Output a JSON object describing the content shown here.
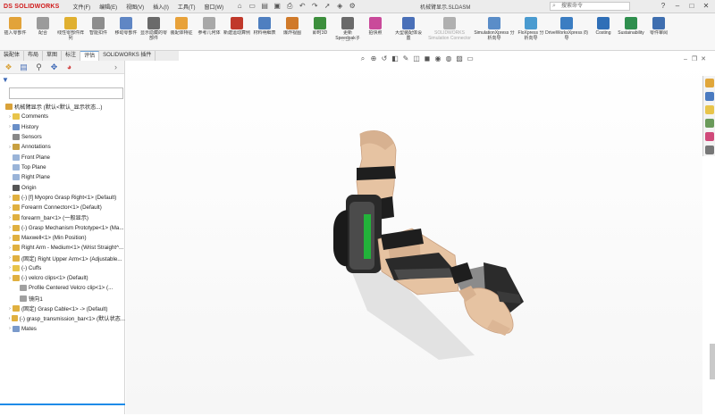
{
  "app": {
    "logo_text": "DS SOLIDWORKS",
    "document_title": "机械臂显示.SLDASM",
    "search_placeholder": "搜索命令"
  },
  "menu": [
    "文件(F)",
    "编辑(E)",
    "视图(V)",
    "插入(I)",
    "工具(T)",
    "窗口(W)"
  ],
  "commands": [
    {
      "label": "插入零部件",
      "color": "#e2a33a",
      "disabled": false
    },
    {
      "label": "配合",
      "color": "#9b9b9b",
      "disabled": false
    },
    {
      "label": "线性零部件阵列",
      "color": "#e0b030",
      "disabled": false
    },
    {
      "label": "智能扣件",
      "color": "#8d8d8d",
      "disabled": false
    },
    {
      "label": "移动零部件",
      "color": "#5f86c4",
      "disabled": false
    },
    {
      "label": "显示隐藏的零部件",
      "color": "#6a6a6a",
      "disabled": false
    },
    {
      "label": "装配体特征",
      "color": "#e8a23a",
      "disabled": false
    },
    {
      "label": "参考几何体",
      "color": "#a8a8a8",
      "disabled": false
    },
    {
      "label": "新建运动算例",
      "color": "#c0392b",
      "disabled": false
    },
    {
      "label": "材料明细表",
      "color": "#4f7fc0",
      "disabled": false
    },
    {
      "label": "爆炸视图",
      "color": "#d07a2a",
      "disabled": false
    },
    {
      "label": "即时3D",
      "color": "#3d8f3d",
      "disabled": false
    },
    {
      "label": "更新Speedpak子装配体",
      "color": "#6a6a6a",
      "disabled": false
    },
    {
      "label": "拍快照",
      "color": "#c94a9a",
      "disabled": false
    },
    {
      "label": "大型装配体设置",
      "color": "#4a70b8",
      "disabled": false
    },
    {
      "label": "SOLIDWORKS Simulation Connector",
      "color": "#b0b0b0",
      "disabled": true
    },
    {
      "label": "SimulationXpress 分析向导",
      "color": "#5a8dc8",
      "disabled": false
    },
    {
      "label": "FloXpress 分析向导",
      "color": "#4a9bd0",
      "disabled": false
    },
    {
      "label": "DriveWorksXpress 向导",
      "color": "#3b7dc2",
      "disabled": false
    },
    {
      "label": "Costing",
      "color": "#2f6fb7",
      "disabled": false
    },
    {
      "label": "Sustainability",
      "color": "#2f8f4e",
      "disabled": false
    },
    {
      "label": "零件审阅",
      "color": "#3f6fb0",
      "disabled": false
    }
  ],
  "tabs": [
    {
      "label": "装配体",
      "active": false
    },
    {
      "label": "布局",
      "active": false
    },
    {
      "label": "草图",
      "active": false
    },
    {
      "label": "标注",
      "active": false
    },
    {
      "label": "评估",
      "active": true
    },
    {
      "label": "SOLIDWORKS 插件",
      "active": false
    }
  ],
  "tree": [
    {
      "label": "机械臂显示 (默认<默认_显示状态...)",
      "indent": 0,
      "icon": "#d9a23a",
      "exp": ""
    },
    {
      "label": "Comments",
      "indent": 1,
      "icon": "#e8c44a",
      "exp": "›"
    },
    {
      "label": "History",
      "indent": 1,
      "icon": "#6a8fc8",
      "exp": "›"
    },
    {
      "label": "Sensors",
      "indent": 1,
      "icon": "#888888",
      "exp": ""
    },
    {
      "label": "Annotations",
      "indent": 1,
      "icon": "#c8a040",
      "exp": "›"
    },
    {
      "label": "Front Plane",
      "indent": 1,
      "icon": "#9ab4d8",
      "exp": ""
    },
    {
      "label": "Top Plane",
      "indent": 1,
      "icon": "#9ab4d8",
      "exp": ""
    },
    {
      "label": "Right Plane",
      "indent": 1,
      "icon": "#9ab4d8",
      "exp": ""
    },
    {
      "label": "Origin",
      "indent": 1,
      "icon": "#555555",
      "exp": ""
    },
    {
      "label": "(-) [f] Myopro Grasp Right<1> (Default)",
      "indent": 1,
      "icon": "#e0b040",
      "exp": "›"
    },
    {
      "label": "Forearm Connector<1> (Default)",
      "indent": 1,
      "icon": "#e0b040",
      "exp": "›"
    },
    {
      "label": "forearm_bar<1> (一般显示)",
      "indent": 1,
      "icon": "#e0b040",
      "exp": "›"
    },
    {
      "label": "(-) Grasp Mechanism Prototype<1> (Ma...",
      "indent": 1,
      "icon": "#e0b040",
      "exp": "›"
    },
    {
      "label": "Maxwell<1> (Min Position)",
      "indent": 1,
      "icon": "#e0b040",
      "exp": "›"
    },
    {
      "label": "Right Arm - Medium<1> (Wrist Straight^...",
      "indent": 1,
      "icon": "#e0b040",
      "exp": "›"
    },
    {
      "label": "(固定) Right Upper Arm<1> (Adjustable...",
      "indent": 1,
      "icon": "#e0b040",
      "exp": "›"
    },
    {
      "label": "(-) Cuffs",
      "indent": 1,
      "icon": "#e8c44a",
      "exp": "›"
    },
    {
      "label": "(-) velcro clips<1> (Default)",
      "indent": 1,
      "icon": "#e0b040",
      "exp": "›"
    },
    {
      "label": "Profile Centered Velcro clip<1> (...",
      "indent": 2,
      "icon": "#a0a0a0",
      "exp": ""
    },
    {
      "label": "镜向1",
      "indent": 2,
      "icon": "#a0a0a0",
      "exp": ""
    },
    {
      "label": "(固定) Grasp Cable<1> -> (Default)",
      "indent": 1,
      "icon": "#e0b040",
      "exp": "›"
    },
    {
      "label": "(-) grasp_transmission_bar<1> (默认状态...",
      "indent": 1,
      "icon": "#e0b040",
      "exp": "›"
    },
    {
      "label": "Mates",
      "indent": 1,
      "icon": "#7a9acb",
      "exp": "›"
    }
  ]
}
